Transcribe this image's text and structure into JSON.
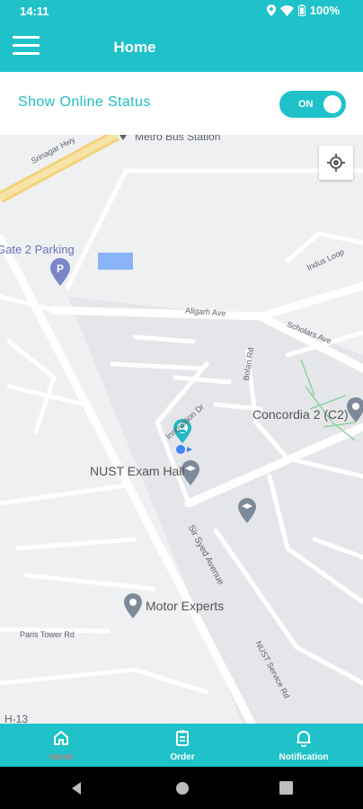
{
  "status_bar": {
    "time": "14:11",
    "battery": "100%"
  },
  "header": {
    "title": "Home",
    "menu_icon": "hamburger-menu-icon"
  },
  "online_status": {
    "label": "Show Online Status",
    "toggle_text": "ON",
    "enabled": true
  },
  "map": {
    "labels": {
      "metro": "Metro Bus Station",
      "srinagar": "Srinagar Hwy",
      "gate2": "Gate 2 Parking",
      "indus": "Indus Loop",
      "aligarh": "Aligarh Ave",
      "scholars": "Scholars Ave",
      "bolan": "Bolan Rd",
      "innovation": "Innovation Dr",
      "concordia": "Concordia 2 (C2)",
      "exam": "NUST Exam Hall",
      "syed": "Sir Syed Avenue",
      "motor": "Motor Experts",
      "paris": "Paris Tower Rd",
      "service": "NUST Service Rd",
      "h13": "H-13"
    }
  },
  "bottom_nav": {
    "items": [
      {
        "label": "Home",
        "icon": "home-icon",
        "active": true
      },
      {
        "label": "Order",
        "icon": "order-list-icon",
        "active": false
      },
      {
        "label": "Notification",
        "icon": "bell-icon",
        "active": false
      }
    ]
  },
  "colors": {
    "primary": "#20c2c9",
    "active_tab": "#f06a5d",
    "map_bg": "#eef0f2"
  }
}
